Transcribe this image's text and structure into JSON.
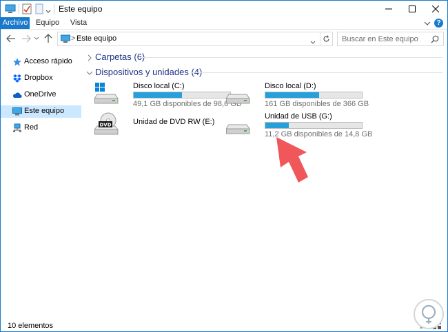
{
  "window": {
    "title": "Este equipo"
  },
  "ribbon": {
    "tabs": [
      {
        "label": "Archivo",
        "active": true
      },
      {
        "label": "Equipo",
        "active": false
      },
      {
        "label": "Vista",
        "active": false
      }
    ],
    "help_label": "?"
  },
  "address": {
    "path": "Este equipo",
    "separator": ">",
    "search_placeholder": "Buscar en Este equipo"
  },
  "sidebar": {
    "items": [
      {
        "label": "Acceso rápido",
        "icon": "star-icon",
        "selected": false
      },
      {
        "label": "Dropbox",
        "icon": "dropbox-icon",
        "selected": false
      },
      {
        "label": "OneDrive",
        "icon": "cloud-icon",
        "selected": false
      },
      {
        "label": "Este equipo",
        "icon": "computer-icon",
        "selected": true
      },
      {
        "label": "Red",
        "icon": "network-icon",
        "selected": false
      }
    ]
  },
  "groups": {
    "folders": {
      "title": "Carpetas (6)",
      "expanded": false
    },
    "devices": {
      "title": "Dispositivos y unidades (4)",
      "expanded": true
    }
  },
  "drives": [
    {
      "name": "Disco local (C:)",
      "free_text": "49,1 GB disponibles de 98,6 GB",
      "used_fraction": 0.502,
      "icon": "windows-drive-icon"
    },
    {
      "name": "Disco local (D:)",
      "free_text": "161 GB disponibles de 366 GB",
      "used_fraction": 0.56,
      "icon": "hard-drive-icon"
    },
    {
      "name": "Unidad de DVD RW (E:)",
      "free_text": "",
      "used_fraction": null,
      "icon": "dvd-drive-icon"
    },
    {
      "name": "Unidad de USB (G:)",
      "free_text": "11,2 GB disponibles de 14,8 GB",
      "used_fraction": 0.243,
      "icon": "usb-drive-icon"
    }
  ],
  "status": {
    "item_count": "10 elementos"
  },
  "colors": {
    "accent": "#1979ca",
    "bar_fill": "#26a0da",
    "selected_bg": "#cce8ff",
    "group_title": "#1e3287",
    "arrow": "#f0575a"
  }
}
